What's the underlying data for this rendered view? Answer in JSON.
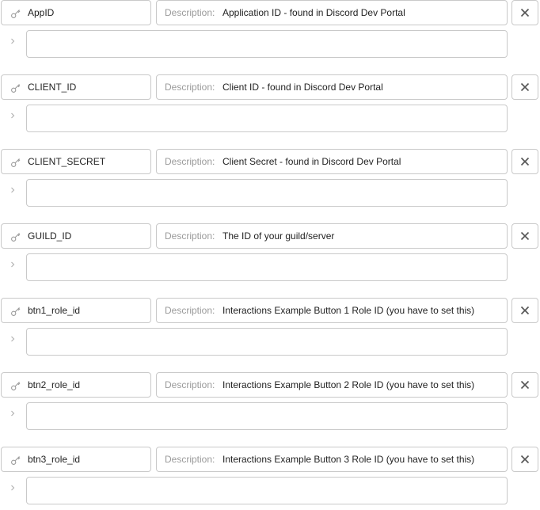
{
  "secrets": [
    {
      "key": "AppID",
      "description_label": "Description:",
      "description": "Application ID - found in Discord Dev Portal",
      "value": ""
    },
    {
      "key": "CLIENT_ID",
      "description_label": "Description:",
      "description": "Client ID - found in Discord Dev Portal",
      "value": ""
    },
    {
      "key": "CLIENT_SECRET",
      "description_label": "Description:",
      "description": "Client Secret - found in Discord Dev Portal",
      "value": ""
    },
    {
      "key": "GUILD_ID",
      "description_label": "Description:",
      "description": "The ID of your guild/server",
      "value": ""
    },
    {
      "key": "btn1_role_id",
      "description_label": "Description:",
      "description": "Interactions Example Button 1 Role ID (you have to set this)",
      "value": ""
    },
    {
      "key": "btn2_role_id",
      "description_label": "Description:",
      "description": "Interactions Example Button 2 Role ID (you have to set this)",
      "value": ""
    },
    {
      "key": "btn3_role_id",
      "description_label": "Description:",
      "description": "Interactions Example Button 3 Role ID (you have to set this)",
      "value": ""
    }
  ],
  "icons": {
    "key": "key-icon",
    "remove": "close-icon",
    "expand": "chevron-right-icon"
  },
  "colors": {
    "border": "#c9c9c9",
    "label": "#9a9a9a",
    "text": "#222222",
    "icon": "#555555"
  }
}
